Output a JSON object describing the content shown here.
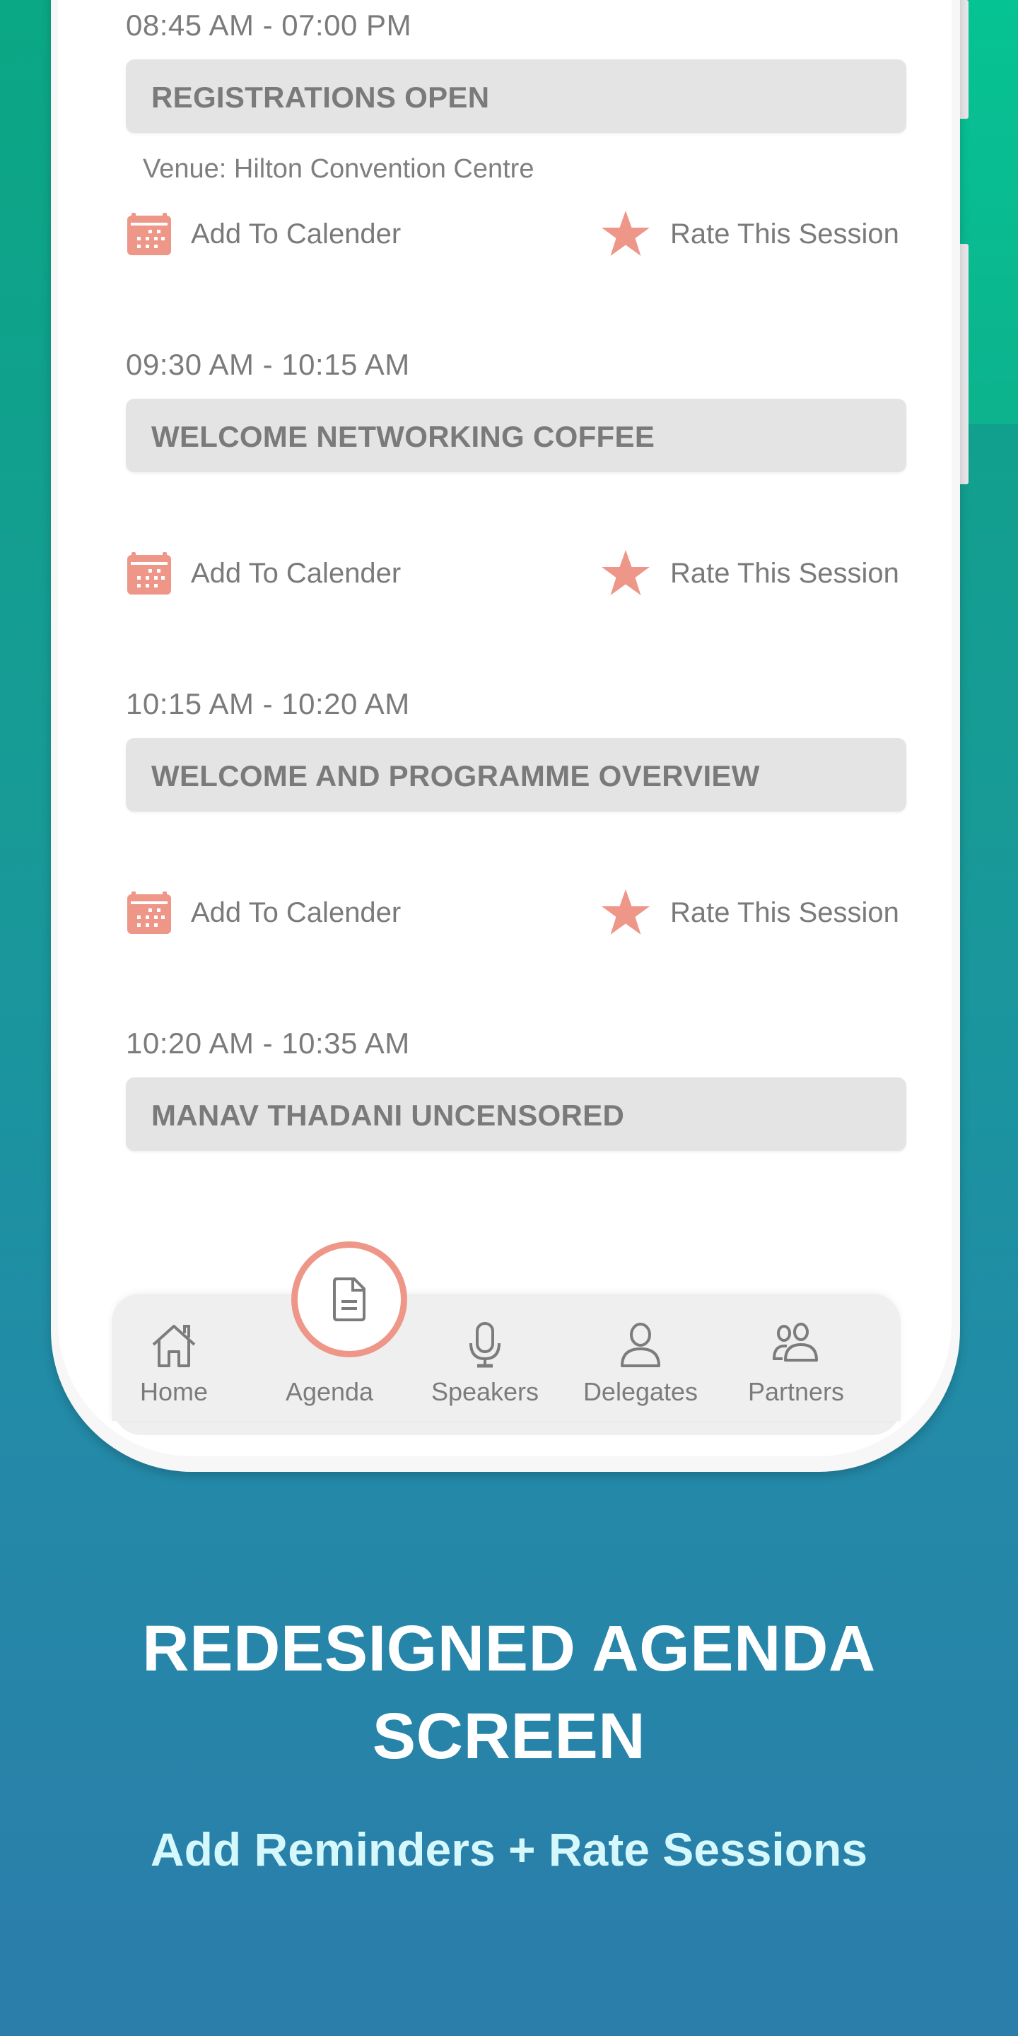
{
  "colors": {
    "accent": "#ee9688",
    "bg_top": "#0aa884",
    "bg_bottom": "#2b7daa",
    "title_box": "#e4e4e4",
    "text_gray": "#7a7a7a"
  },
  "sessions": [
    {
      "time": "08:45 AM - 07:00 PM",
      "title": "REGISTRATIONS OPEN",
      "venue": "Venue: Hilton Convention Centre",
      "add_calendar_label": "Add To Calender",
      "rate_label": "Rate This Session"
    },
    {
      "time": "09:30 AM - 10:15 AM",
      "title": "WELCOME NETWORKING COFFEE",
      "venue": "",
      "add_calendar_label": "Add To Calender",
      "rate_label": "Rate This Session"
    },
    {
      "time": "10:15 AM - 10:20 AM",
      "title": "WELCOME AND PROGRAMME OVERVIEW",
      "venue": "",
      "add_calendar_label": "Add To Calender",
      "rate_label": "Rate This Session"
    },
    {
      "time": "10:20 AM - 10:35 AM",
      "title": "MANAV THADANI UNCENSORED"
    }
  ],
  "nav": {
    "active": "Agenda",
    "items": [
      {
        "label": "Home",
        "icon": "home-icon"
      },
      {
        "label": "Agenda",
        "icon": "document-icon"
      },
      {
        "label": "Speakers",
        "icon": "microphone-icon"
      },
      {
        "label": "Delegates",
        "icon": "person-icon"
      },
      {
        "label": "Partners",
        "icon": "people-icon"
      }
    ]
  },
  "promo": {
    "title_line1": "REDESIGNED AGENDA",
    "title_line2": "SCREEN",
    "subtitle": "Add Reminders + Rate Sessions"
  }
}
